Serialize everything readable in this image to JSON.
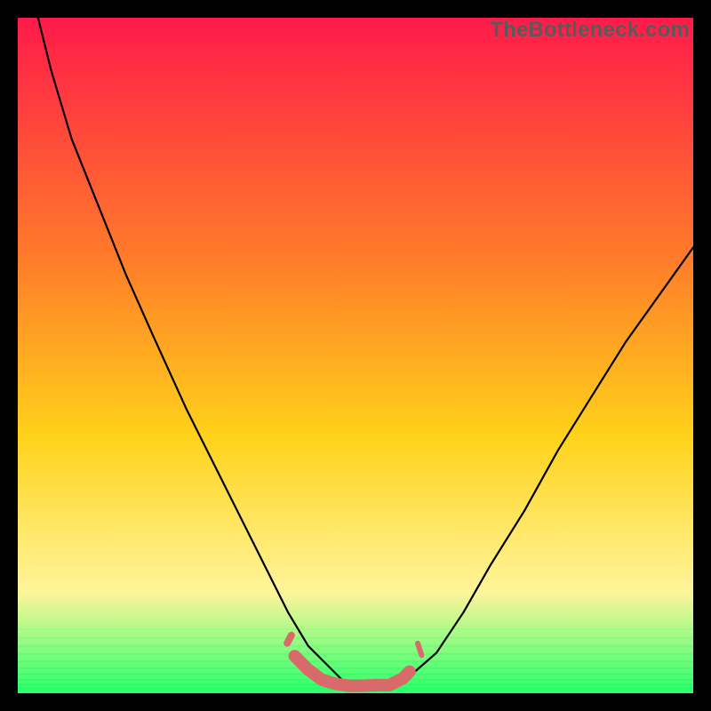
{
  "watermark": "TheBottleneck.com",
  "colors": {
    "background": "#000000",
    "gradient_top": "#ff1a4a",
    "gradient_mid1": "#ff7a2a",
    "gradient_mid2": "#ffd21a",
    "gradient_mid3": "#fff59a",
    "gradient_bottom": "#2cff6e",
    "curve": "#000000",
    "marker": "#d86a6a"
  },
  "chart_data": {
    "type": "line",
    "title": "",
    "xlabel": "",
    "ylabel": "",
    "xlim": [
      0,
      100
    ],
    "ylim": [
      0,
      100
    ],
    "series": [
      {
        "name": "bottleneck-curve",
        "x": [
          3,
          5,
          8,
          12,
          16,
          20,
          25,
          30,
          35,
          40,
          43,
          46,
          48,
          50,
          52,
          55,
          58,
          62,
          66,
          70,
          75,
          80,
          85,
          90,
          95,
          100
        ],
        "y": [
          100,
          92,
          82,
          72,
          62,
          53,
          42,
          32,
          22,
          12,
          7,
          4,
          2,
          1,
          1.2,
          1,
          2.5,
          6,
          12,
          19,
          27,
          36,
          44,
          52,
          59,
          66
        ]
      }
    ],
    "markers": {
      "name": "highlight-band",
      "x": [
        41,
        43,
        45,
        47,
        49,
        51,
        53,
        55,
        57,
        58
      ],
      "y": [
        5.5,
        3.5,
        2,
        1.4,
        1.1,
        1.1,
        1.2,
        1.2,
        2.2,
        3.2
      ]
    }
  }
}
